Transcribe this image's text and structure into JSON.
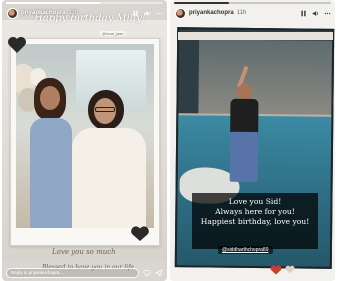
{
  "stories": [
    {
      "username": "priyankachopra",
      "timestamp": "11h",
      "progress_fraction": 0.6,
      "title": "Happy birthday Milly!",
      "mention_tag": "@maa_jaan",
      "caption_line1": "Love you so much",
      "caption_line2": "Blessed to have you in our life",
      "reply_placeholder": "Reply to priyankachopra...",
      "icons": [
        "pause-icon",
        "volume-icon",
        "more-icon",
        "heart-icon",
        "send-icon"
      ]
    },
    {
      "username": "priyankachopra",
      "timestamp": "11h",
      "progress_fraction": 0.35,
      "caption_lines": [
        "Love you Sid!",
        "Always here for you!",
        "Happiest birthday, love you!"
      ],
      "mention": "@siddharthchopra89",
      "icons": [
        "pause-icon",
        "volume-icon",
        "more-icon",
        "heart-icon"
      ]
    }
  ],
  "colors": {
    "caption_box": "#000000",
    "heart_dark": "#2c2a29",
    "heart_red": "#c9402e"
  }
}
